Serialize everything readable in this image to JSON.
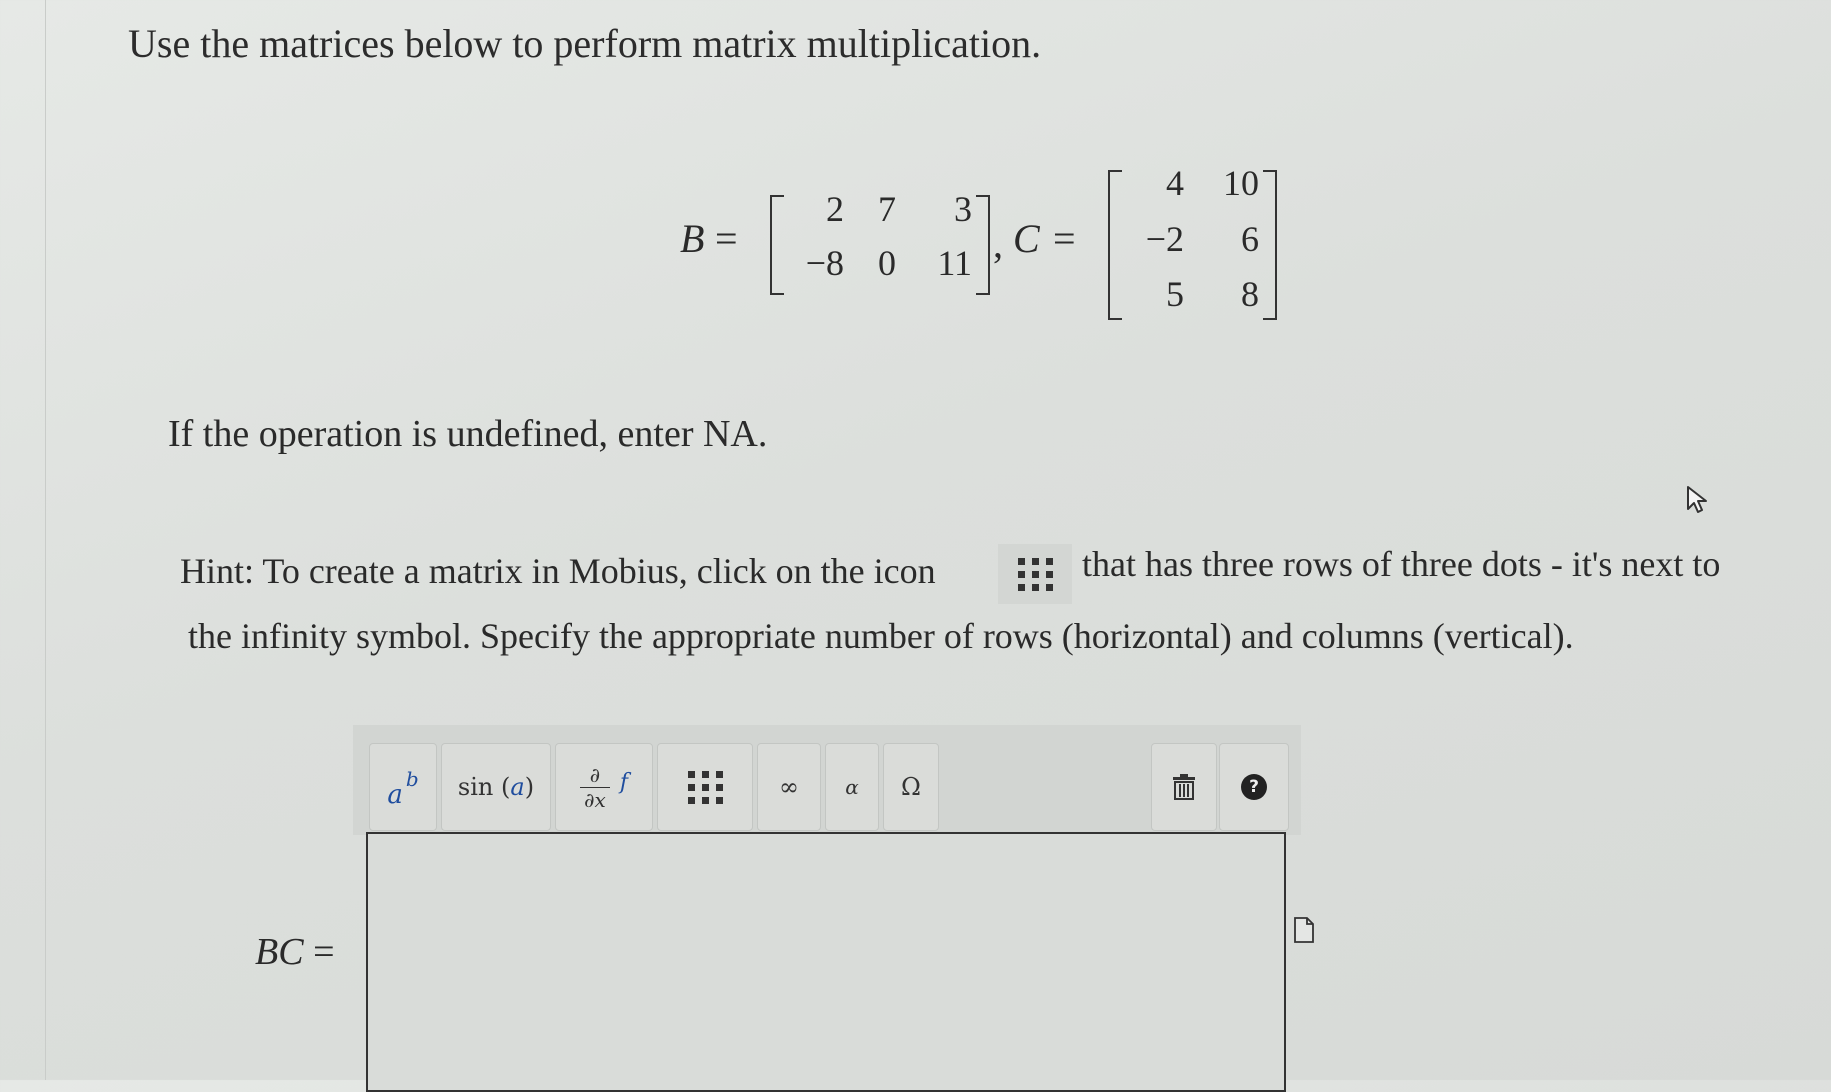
{
  "question": {
    "title": "Use the matrices below to perform matrix multiplication.",
    "matrix_b": {
      "name": "B",
      "rows": [
        [
          "2",
          "7",
          "3"
        ],
        [
          "−8",
          "0",
          "11"
        ]
      ]
    },
    "matrix_c": {
      "name": "C",
      "rows": [
        [
          "4",
          "10"
        ],
        [
          "−2",
          "6"
        ],
        [
          "5",
          "8"
        ]
      ]
    },
    "equals": "=",
    "comma": ",",
    "undefined_note": "If the operation is undefined, enter NA.",
    "hint_part1": "Hint: To create a matrix in Mobius, click on the icon",
    "hint_part2": "that has three rows of three dots - it's next to",
    "hint_part3": "the infinity symbol. Specify the appropriate number of rows (horizontal) and columns (vertical)."
  },
  "toolbar": {
    "power_base": "a",
    "power_exp": "b",
    "sin_label": "sin",
    "sin_arg": "a",
    "deriv_top": "∂",
    "deriv_bottom": "∂x",
    "integral": "f",
    "infinity": "∞",
    "alpha": "α",
    "omega": "Ω",
    "help": "?"
  },
  "answer": {
    "label_var": "BC",
    "label_eq": "="
  }
}
